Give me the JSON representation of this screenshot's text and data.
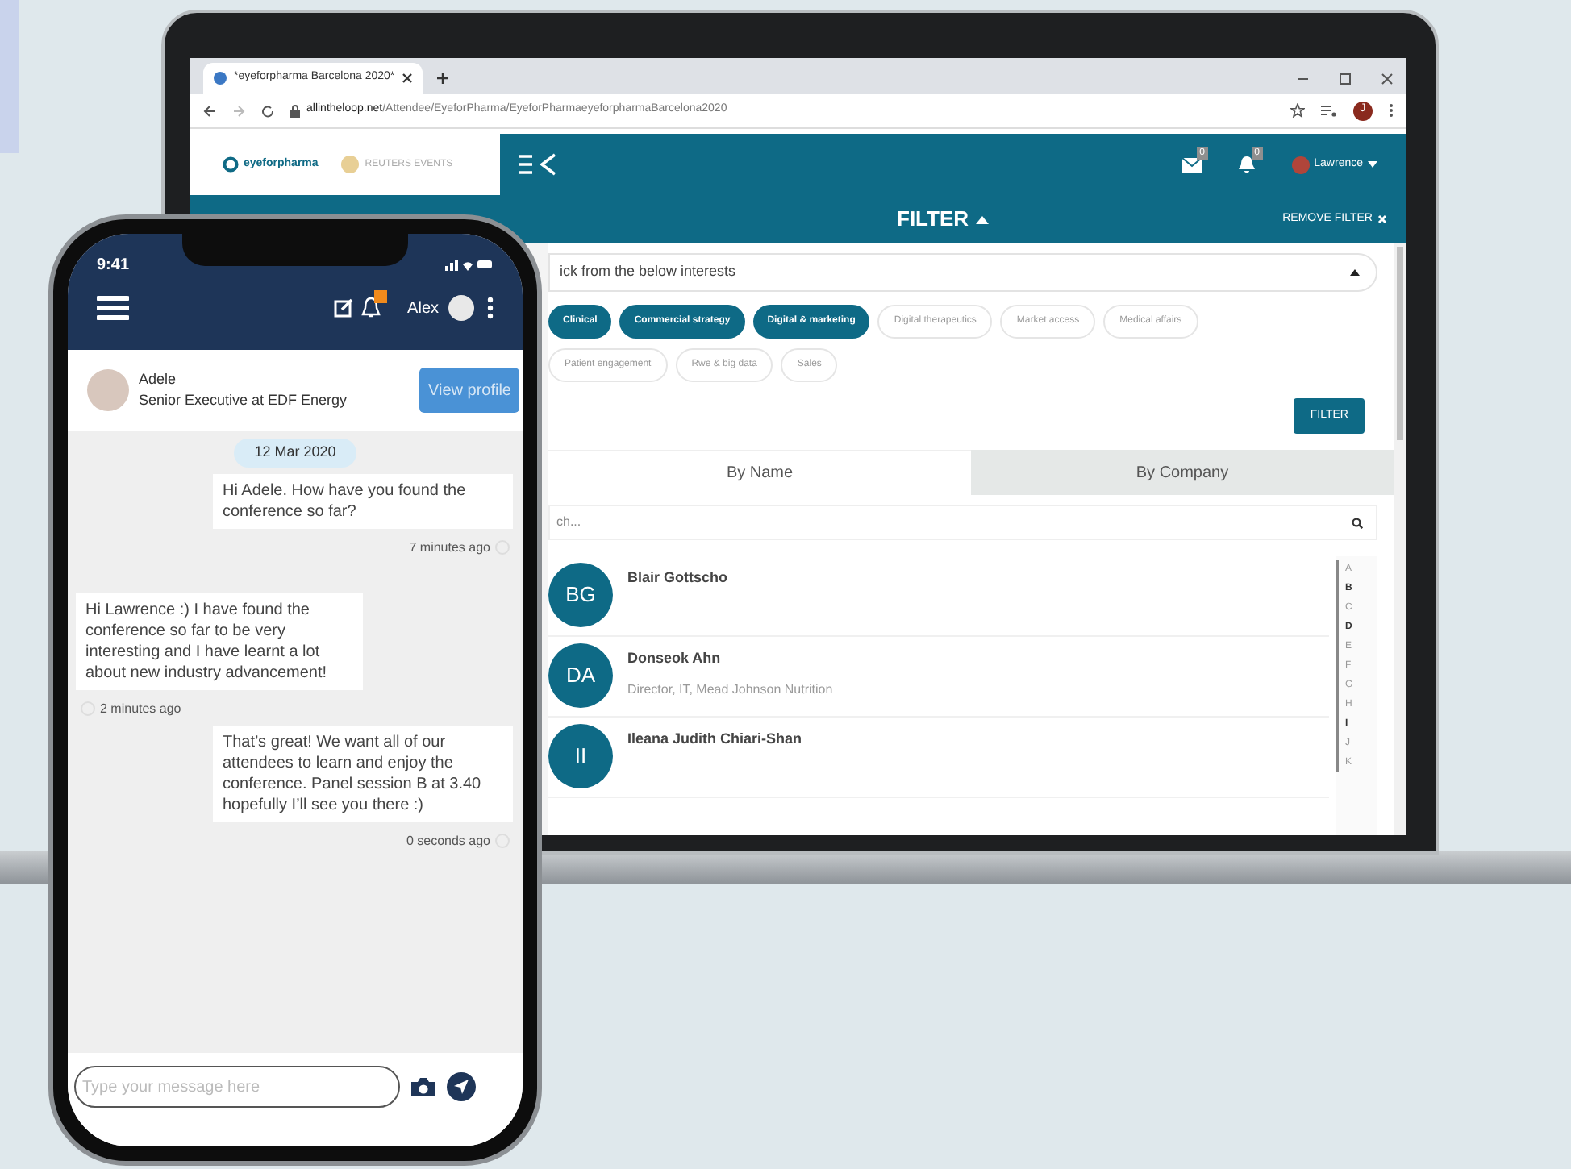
{
  "browser": {
    "tab_title": "*eyeforpharma Barcelona 2020*",
    "url_domain": "allintheloop.net",
    "url_path": "/Attendee/EyeforPharma/EyeforPharmaeyeforpharmaBarcelona2020",
    "profile_initial": "J"
  },
  "app_header": {
    "logos": [
      "eyeforpharma",
      "REUTERS EVENTS"
    ],
    "mail_count": "0",
    "notification_count": "0",
    "user": "Lawrence"
  },
  "filter_bar": {
    "title": "FILTER",
    "remove": "REMOVE FILTER"
  },
  "filter": {
    "select_text": "ick from the below interests",
    "button": "FILTER",
    "chips": [
      {
        "label": "Clinical",
        "selected": true
      },
      {
        "label": "Commercial strategy",
        "selected": true
      },
      {
        "label": "Digital & marketing",
        "selected": true
      },
      {
        "label": "Digital therapeutics",
        "selected": false
      },
      {
        "label": "Market access",
        "selected": false
      },
      {
        "label": "Medical affairs",
        "selected": false
      },
      {
        "label": "Patient engagement",
        "selected": false
      },
      {
        "label": "Rwe & big data",
        "selected": false
      },
      {
        "label": "Sales",
        "selected": false
      }
    ]
  },
  "tabs": [
    {
      "label": "By Name",
      "selected": true
    },
    {
      "label": "By Company",
      "selected": false
    }
  ],
  "search": {
    "placeholder": "ch..."
  },
  "attendees": [
    {
      "initials": "BG",
      "name": "Blair Gottscho"
    },
    {
      "initials": "DA",
      "name": "Donseok Ahn",
      "title": "Director, IT, Mead Johnson Nutrition"
    },
    {
      "initials": "II",
      "name": "Ileana Judith Chiari-Shan"
    }
  ],
  "alphabet": [
    {
      "letter": "A",
      "active": false
    },
    {
      "letter": "B",
      "active": true
    },
    {
      "letter": "C",
      "active": false
    },
    {
      "letter": "D",
      "active": true
    },
    {
      "letter": "E",
      "active": false
    },
    {
      "letter": "F",
      "active": false
    },
    {
      "letter": "G",
      "active": false
    },
    {
      "letter": "H",
      "active": false
    },
    {
      "letter": "I",
      "active": true
    },
    {
      "letter": "J",
      "active": false
    },
    {
      "letter": "K",
      "active": false
    }
  ],
  "phone": {
    "time": "9:41",
    "user": "Alex",
    "contact": {
      "name": "Adele",
      "role": "Senior Executive at EDF Energy",
      "button": "View profile"
    },
    "date": "12 Mar 2020",
    "messages": [
      {
        "kind": "sent",
        "text": "Hi Adele. How have you found the conference so far?",
        "time": "7 minutes ago"
      },
      {
        "kind": "received",
        "text": "Hi Lawrence :) I have found the conference so far to be very interesting and I have learnt a lot about new industry advancement!",
        "time": "2 minutes ago"
      },
      {
        "kind": "sent",
        "text": "That’s great! We want all of our attendees to learn and enjoy the conference. Panel session B at 3.40 hopefully I’ll see you there :)",
        "time": "0 seconds ago"
      }
    ],
    "input_placeholder": "Type your message here"
  }
}
